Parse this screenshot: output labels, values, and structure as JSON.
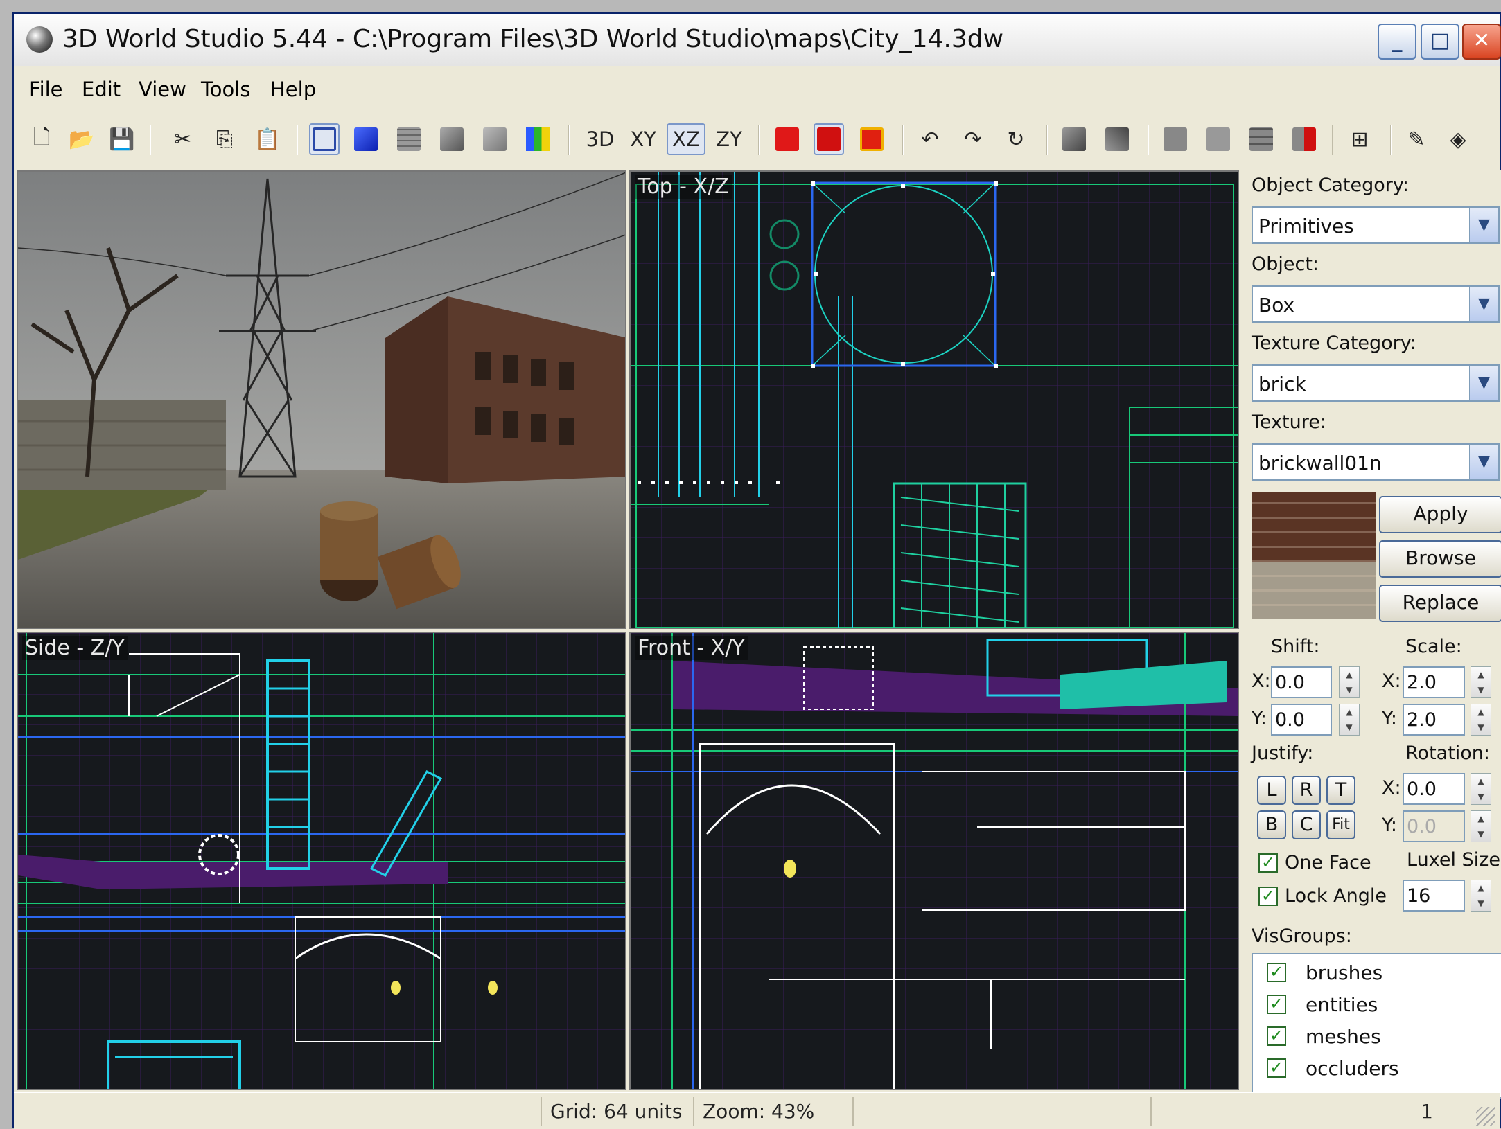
{
  "window": {
    "title": "3D World Studio 5.44 - C:\\Program Files\\3D World Studio\\maps\\City_14.3dw",
    "minimize": "_",
    "maximize": "□",
    "close": "✕"
  },
  "menu": [
    "File",
    "Edit",
    "View",
    "Tools",
    "Help"
  ],
  "toolbar": {
    "view_3d": "3D",
    "view_xy": "XY",
    "view_xz": "XZ",
    "view_zy": "ZY"
  },
  "viewports": {
    "top": "Top - X/Z",
    "side": "Side - Z/Y",
    "front": "Front - X/Y"
  },
  "panel": {
    "object_category_label": "Object Category:",
    "object_category_value": "Primitives",
    "object_label": "Object:",
    "object_value": "Box",
    "texture_category_label": "Texture Category:",
    "texture_category_value": "brick",
    "texture_label": "Texture:",
    "texture_value": "brickwall01n",
    "apply": "Apply",
    "browse": "Browse",
    "replace": "Replace",
    "shift_label": "Shift:",
    "scale_label": "Scale:",
    "x": "X:",
    "y": "Y:",
    "shift_x": "0.0",
    "shift_y": "0.0",
    "scale_x": "2.0",
    "scale_y": "2.0",
    "justify_label": "Justify:",
    "rotation_label": "Rotation:",
    "rotation_x": "0.0",
    "rotation_y": "0.0",
    "justify_l": "L",
    "justify_r": "R",
    "justify_t": "T",
    "justify_b": "B",
    "justify_c": "C",
    "justify_fit": "Fit",
    "one_face": "One Face",
    "lock_angle": "Lock Angle",
    "luxel_label": "Luxel Size:",
    "luxel_value": "16",
    "visgroups_label": "VisGroups:",
    "visgroups": [
      "brushes",
      "entities",
      "meshes",
      "occluders"
    ]
  },
  "status": {
    "grid": "Grid: 64 units",
    "zoom": "Zoom: 43%",
    "count": "1"
  }
}
